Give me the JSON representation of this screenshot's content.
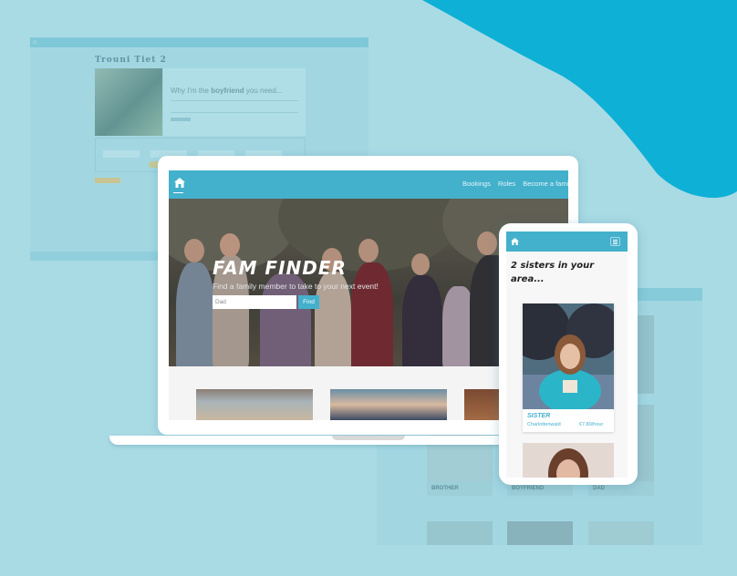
{
  "colors": {
    "background": "#a9dbe5",
    "accent": "#43b0cc",
    "blob": "#0eb0d6"
  },
  "back_left_window": {
    "title": "Trouni Tiet 2",
    "card_heading_pre": "Why I'm the ",
    "card_heading_bold": "boyfriend",
    "card_heading_post": " you need..."
  },
  "back_right_window": {
    "tiles": [
      "BROTHER",
      "BOYFRIEND",
      "DAD"
    ]
  },
  "laptop": {
    "nav": {
      "home_icon": "home-icon",
      "links": [
        "Bookings",
        "Roles",
        "Become a family m"
      ]
    },
    "hero": {
      "title": "FAM FINDER",
      "subtitle": "Find a family member to take to your next event!",
      "search_value": "Dad",
      "search_button": "Find"
    }
  },
  "phone": {
    "nav": {
      "home_icon": "home-icon",
      "menu_icon": "hamburger-menu-icon"
    },
    "heading": "2 sisters in your area...",
    "card": {
      "name": "SISTER",
      "location": "Charlottenwald",
      "price": "€7.89/hour"
    }
  }
}
